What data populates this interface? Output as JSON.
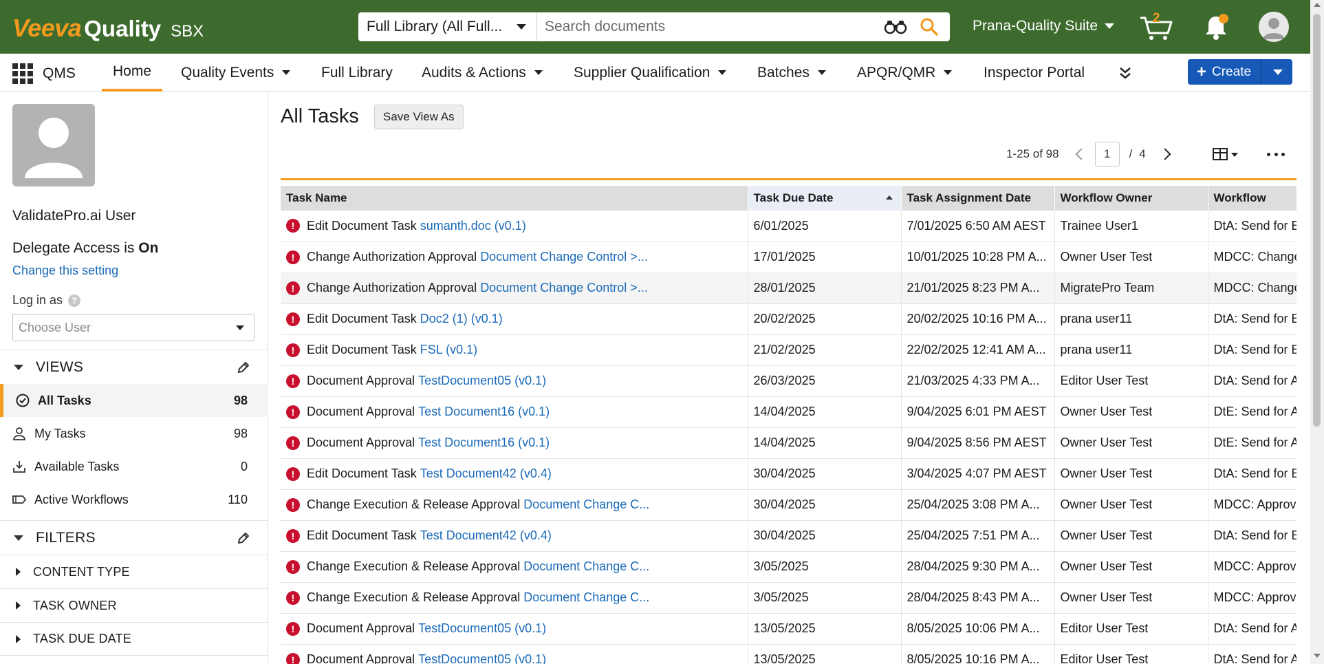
{
  "brand": {
    "veeva": "Veeva",
    "product": "Quality",
    "env": "SBX"
  },
  "search": {
    "library": "Full Library (All Full...",
    "placeholder": "Search documents"
  },
  "suite": {
    "name": "Prana-Quality Suite"
  },
  "cart": {
    "count": "2"
  },
  "nav": {
    "app": "QMS",
    "items": [
      "Home",
      "Quality Events",
      "Full Library",
      "Audits & Actions",
      "Supplier Qualification",
      "Batches",
      "APQR/QMR",
      "Inspector Portal"
    ],
    "create": "Create"
  },
  "sidebar": {
    "user": "ValidatePro.ai User",
    "delegate_prefix": "Delegate Access is",
    "delegate_state": "On",
    "change_setting": "Change this setting",
    "login_as": "Log in as",
    "choose_user": "Choose User",
    "views_title": "VIEWS",
    "views": [
      {
        "label": "All Tasks",
        "count": "98",
        "icon": "check-circle-icon"
      },
      {
        "label": "My Tasks",
        "count": "98",
        "icon": "person-icon"
      },
      {
        "label": "Available Tasks",
        "count": "0",
        "icon": "inbox-icon"
      },
      {
        "label": "Active Workflows",
        "count": "110",
        "icon": "workflow-icon"
      }
    ],
    "filters_title": "FILTERS",
    "filters": [
      "CONTENT TYPE",
      "TASK OWNER",
      "TASK DUE DATE"
    ]
  },
  "main": {
    "title": "All Tasks",
    "save_view": "Save View As",
    "range": "1-25 of 98",
    "page": "1",
    "slash": "/",
    "pages": "4"
  },
  "table": {
    "headers": [
      "Task Name",
      "Task Due Date",
      "Task Assignment Date",
      "Workflow Owner",
      "Workflow"
    ],
    "rows": [
      {
        "task": "Edit Document Task",
        "link": "sumanth.doc (v0.1)",
        "due": "6/01/2025",
        "assigned": "7/01/2025 6:50 AM AEST",
        "owner": "Trainee User1",
        "workflow": "DtA: Send for Edit"
      },
      {
        "task": "Change Authorization Approval",
        "link": "Document Change Control >...",
        "due": "17/01/2025",
        "assigned": "10/01/2025 10:28 PM A...",
        "owner": "Owner User Test",
        "workflow": "MDCC: Change"
      },
      {
        "task": "Change Authorization Approval",
        "link": "Document Change Control >...",
        "due": "28/01/2025",
        "assigned": "21/01/2025 8:23 PM A...",
        "owner": "MigratePro Team",
        "workflow": "MDCC: Change"
      },
      {
        "task": "Edit Document Task",
        "link": "Doc2 (1) (v0.1)",
        "due": "20/02/2025",
        "assigned": "20/02/2025 10:16 PM A...",
        "owner": "prana user11",
        "workflow": "DtA: Send for Edit"
      },
      {
        "task": "Edit Document Task",
        "link": "FSL (v0.1)",
        "due": "21/02/2025",
        "assigned": "22/02/2025 12:41 AM A...",
        "owner": "prana user11",
        "workflow": "DtA: Send for Edit"
      },
      {
        "task": "Document Approval",
        "link": "TestDocument05 (v0.1)",
        "due": "26/03/2025",
        "assigned": "21/03/2025 4:33 PM A...",
        "owner": "Editor User Test",
        "workflow": "DtA: Send for Approval"
      },
      {
        "task": "Document Approval",
        "link": "Test Document16 (v0.1)",
        "due": "14/04/2025",
        "assigned": "9/04/2025 6:01 PM AEST",
        "owner": "Owner User Test",
        "workflow": "DtE: Send for Approval"
      },
      {
        "task": "Document Approval",
        "link": "Test Document16 (v0.1)",
        "due": "14/04/2025",
        "assigned": "9/04/2025 8:56 PM AEST",
        "owner": "Owner User Test",
        "workflow": "DtE: Send for Approval"
      },
      {
        "task": "Edit Document Task",
        "link": "Test Document42 (v0.4)",
        "due": "30/04/2025",
        "assigned": "3/04/2025 4:07 PM AEST",
        "owner": "Owner User Test",
        "workflow": "DtA: Send for Edit"
      },
      {
        "task": "Change Execution & Release Approval",
        "link": "Document Change C...",
        "due": "30/04/2025",
        "assigned": "25/04/2025 3:08 PM A...",
        "owner": "Owner User Test",
        "workflow": "MDCC: Approval"
      },
      {
        "task": "Edit Document Task",
        "link": "Test Document42 (v0.4)",
        "due": "30/04/2025",
        "assigned": "25/04/2025 7:51 PM A...",
        "owner": "Owner User Test",
        "workflow": "DtA: Send for Edit"
      },
      {
        "task": "Change Execution & Release Approval",
        "link": "Document Change C...",
        "due": "3/05/2025",
        "assigned": "28/04/2025 9:30 PM A...",
        "owner": "Owner User Test",
        "workflow": "MDCC: Approval"
      },
      {
        "task": "Change Execution & Release Approval",
        "link": "Document Change C...",
        "due": "3/05/2025",
        "assigned": "28/04/2025 8:43 PM A...",
        "owner": "Owner User Test",
        "workflow": "MDCC: Approval"
      },
      {
        "task": "Document Approval",
        "link": "TestDocument05 (v0.1)",
        "due": "13/05/2025",
        "assigned": "8/05/2025 10:06 PM A...",
        "owner": "Editor User Test",
        "workflow": "DtA: Send for Approval"
      },
      {
        "task": "Document Approval",
        "link": "TestDocument05 (v0.1)",
        "due": "13/05/2025",
        "assigned": "8/05/2025 10:16 PM A...",
        "owner": "Editor User Test",
        "workflow": "DtA: Send for Approval"
      }
    ]
  },
  "colors": {
    "header_green": "#3d6b2e",
    "accent_orange": "#f39a1d",
    "link_blue": "#1a6ab8",
    "create_blue": "#1659b6",
    "error_red": "#c8102e"
  }
}
